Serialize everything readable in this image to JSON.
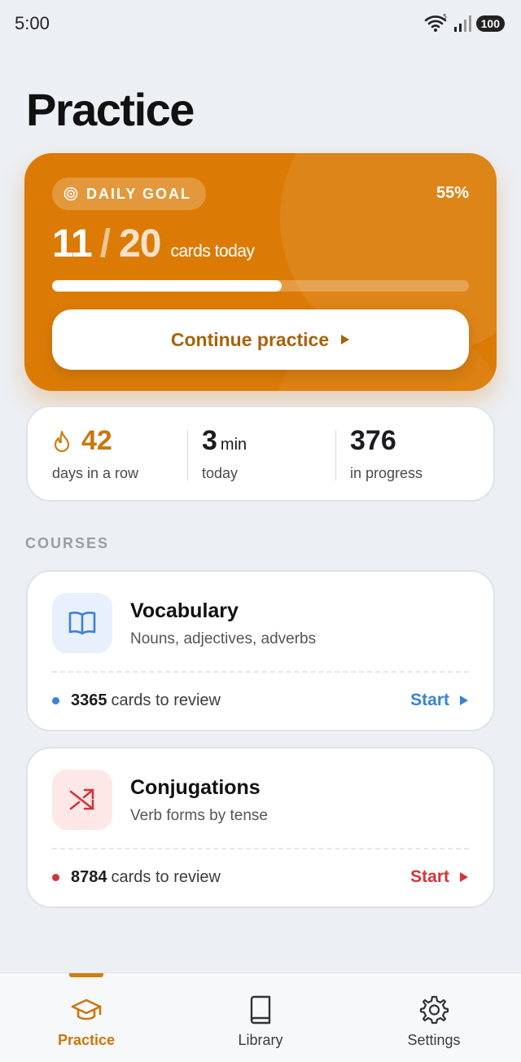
{
  "status_bar": {
    "time": "5:00",
    "battery": "100"
  },
  "page_title": "Practice",
  "daily_goal": {
    "badge": "DAILY GOAL",
    "percent_label": "55%",
    "progress_fraction": 0.55,
    "done": "11",
    "separator": "/",
    "total": "20",
    "unit": "cards today",
    "continue_label": "Continue practice"
  },
  "stats": [
    {
      "value": "42",
      "unit": "",
      "label": "days in a row"
    },
    {
      "value": "3",
      "unit": "min",
      "label": "today"
    },
    {
      "value": "376",
      "unit": "",
      "label": "in progress"
    }
  ],
  "courses_label": "COURSES",
  "courses": [
    {
      "title": "Vocabulary",
      "subtitle": "Nouns, adjectives, adverbs",
      "review_count": "3365",
      "review_text": "cards to review",
      "action": "Start",
      "accent": "#3b82d6",
      "icon_bg": "#e7f0fc",
      "icon": "book-icon"
    },
    {
      "title": "Conjugations",
      "subtitle": "Verb forms by tense",
      "review_count": "8784",
      "review_text": "cards to review",
      "action": "Start",
      "accent": "#d3343a",
      "icon_bg": "#fde7e7",
      "icon": "shuffle-icon"
    }
  ],
  "tabs": [
    {
      "label": "Practice",
      "active": true,
      "icon": "graduation-cap-icon"
    },
    {
      "label": "Library",
      "active": false,
      "icon": "book-icon"
    },
    {
      "label": "Settings",
      "active": false,
      "icon": "gear-icon"
    }
  ],
  "colors": {
    "accent": "#db7b06",
    "accent_dark": "#a8620a",
    "tab_active": "#c9770c"
  }
}
